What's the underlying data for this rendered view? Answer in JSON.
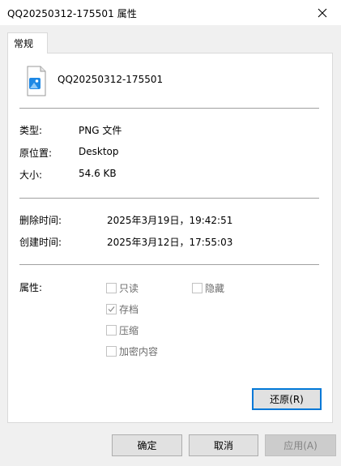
{
  "window": {
    "title": "QQ20250312-175501 属性"
  },
  "tabs": [
    {
      "label": "常规",
      "active": true
    }
  ],
  "file": {
    "name": "QQ20250312-175501",
    "icon": "image-file-icon"
  },
  "general": {
    "type_label": "类型:",
    "type_value": "PNG 文件",
    "location_label": "原位置:",
    "location_value": "Desktop",
    "size_label": "大小:",
    "size_value": "54.6 KB"
  },
  "times": {
    "deleted_label": "删除时间:",
    "deleted_value": "2025年3月19日，19:42:51",
    "created_label": "创建时间:",
    "created_value": "2025年3月12日，17:55:03"
  },
  "attributes": {
    "label": "属性:",
    "readonly": {
      "label": "只读",
      "checked": false
    },
    "hidden": {
      "label": "隐藏",
      "checked": false
    },
    "archive": {
      "label": "存档",
      "checked": true
    },
    "compress": {
      "label": "压缩",
      "checked": false
    },
    "encrypt": {
      "label": "加密内容",
      "checked": false
    }
  },
  "buttons": {
    "restore": "还原(R)",
    "ok": "确定",
    "cancel": "取消",
    "apply": "应用(A)"
  },
  "colors": {
    "accent": "#0078d7",
    "background": "#f0f0f0"
  }
}
